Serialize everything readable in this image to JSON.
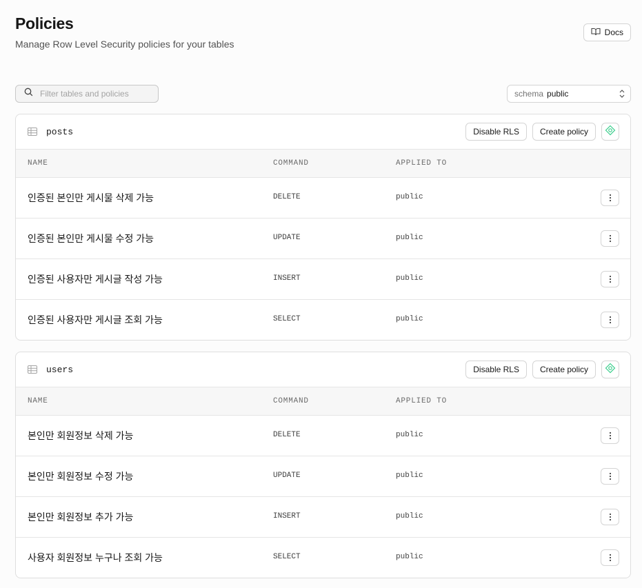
{
  "header": {
    "title": "Policies",
    "subtitle": "Manage Row Level Security policies for your tables",
    "docs_label": "Docs"
  },
  "filter": {
    "placeholder": "Filter tables and policies",
    "value": ""
  },
  "schema": {
    "label": "schema",
    "value": "public"
  },
  "columns": {
    "name": "NAME",
    "command": "COMMAND",
    "applied_to": "APPLIED TO"
  },
  "tables": [
    {
      "name": "posts",
      "disable_rls_label": "Disable RLS",
      "create_policy_label": "Create policy",
      "policies": [
        {
          "name": "인증된 본인만 게시물 삭제 가능",
          "command": "DELETE",
          "applied_to": "public"
        },
        {
          "name": "인증된 본인만 게시물 수정 가능",
          "command": "UPDATE",
          "applied_to": "public"
        },
        {
          "name": "인증된 사용자만 게시글 작성 가능",
          "command": "INSERT",
          "applied_to": "public"
        },
        {
          "name": "인증된 사용자만 게시글 조회 가능",
          "command": "SELECT",
          "applied_to": "public"
        }
      ]
    },
    {
      "name": "users",
      "disable_rls_label": "Disable RLS",
      "create_policy_label": "Create policy",
      "policies": [
        {
          "name": "본인만 회원정보 삭제 가능",
          "command": "DELETE",
          "applied_to": "public"
        },
        {
          "name": "본인만 회원정보 수정 가능",
          "command": "UPDATE",
          "applied_to": "public"
        },
        {
          "name": "본인만 회원정보 추가 가능",
          "command": "INSERT",
          "applied_to": "public"
        },
        {
          "name": "사용자 회원정보 누구나 조회 가능",
          "command": "SELECT",
          "applied_to": "public"
        }
      ]
    }
  ],
  "colors": {
    "accent": "#3ecf8e",
    "border": "#dedede",
    "muted_text": "#737373"
  },
  "icons": [
    "book-icon",
    "search-icon",
    "chevron-updown-icon",
    "table-icon",
    "ai-assistant-icon",
    "more-vertical-icon"
  ]
}
